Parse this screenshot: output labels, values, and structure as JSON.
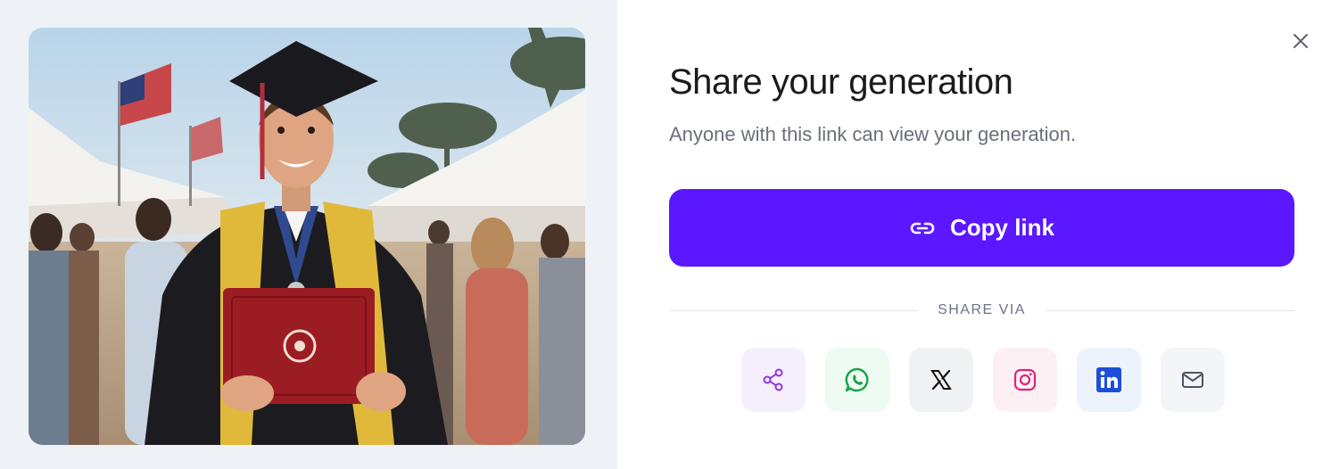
{
  "modal": {
    "title": "Share your generation",
    "subtitle": "Anyone with this link can view your generation.",
    "copy_label": "Copy link",
    "share_via_label": "SHARE VIA"
  },
  "share_options": [
    {
      "name": "share",
      "icon": "share-icon",
      "bg": "#f6f0fe",
      "fg": "#9333ea"
    },
    {
      "name": "whatsapp",
      "icon": "whatsapp-icon",
      "bg": "#eefbf2",
      "fg": "#16a34a"
    },
    {
      "name": "x",
      "icon": "x-icon",
      "bg": "#f0f1f4",
      "fg": "#111111"
    },
    {
      "name": "instagram",
      "icon": "instagram-icon",
      "bg": "#fdf0f5",
      "fg": "#db2777"
    },
    {
      "name": "linkedin",
      "icon": "linkedin-icon",
      "bg": "#edf3fd",
      "fg": "#1d4ed8"
    },
    {
      "name": "email",
      "icon": "mail-icon",
      "bg": "#f4f5f8",
      "fg": "#4b5563"
    }
  ],
  "colors": {
    "accent": "#5b17ff",
    "left_pane_bg": "#eef2f7",
    "title": "#1a1a1f",
    "muted": "#6b6f7a"
  },
  "image": {
    "subject": "graduate-photo"
  }
}
